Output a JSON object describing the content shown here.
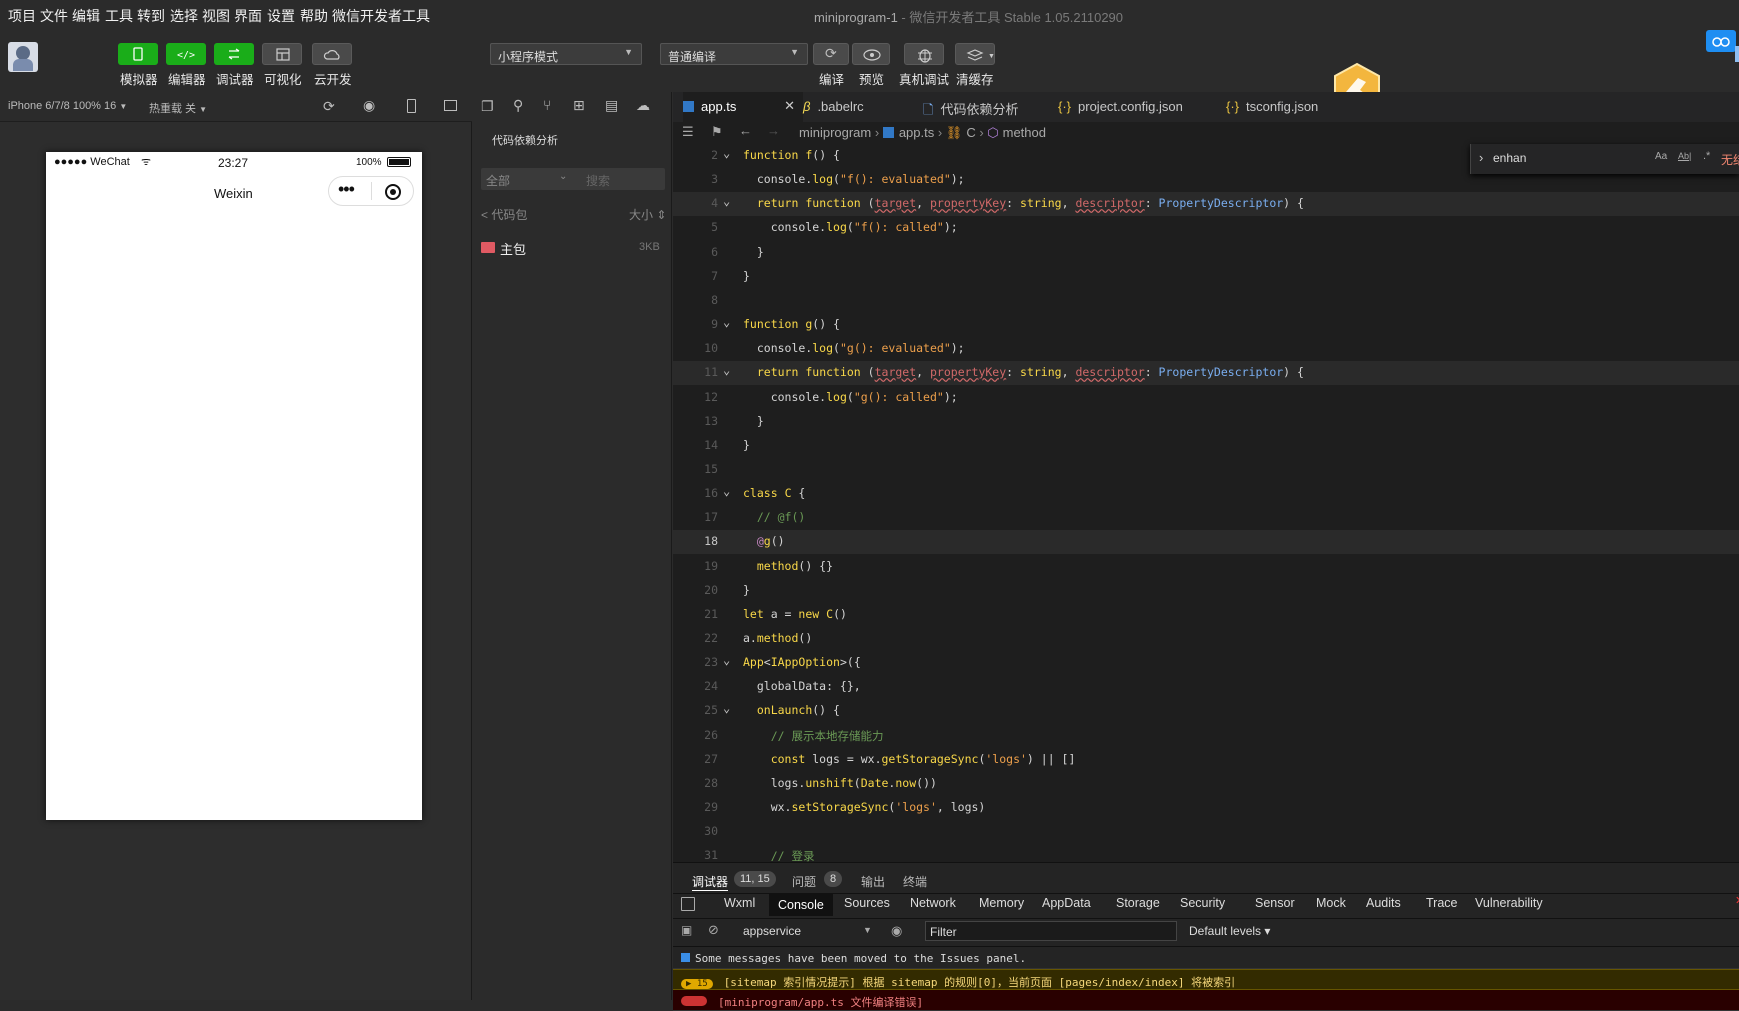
{
  "menu": [
    "项目",
    "文件",
    "编辑",
    "工具",
    "转到",
    "选择",
    "视图",
    "界面",
    "设置",
    "帮助",
    "微信开发者工具"
  ],
  "window_title": {
    "app": "miniprogram-1",
    "rest": " - 微信开发者工具 Stable 1.05.2110290"
  },
  "toolbar": {
    "buttons": [
      "模拟器",
      "编辑器",
      "调试器",
      "可视化",
      "云开发"
    ],
    "mode_select": "小程序模式",
    "compile_select": "普通编译",
    "right_labels": [
      "编译",
      "预览",
      "真机调试",
      "清缓存"
    ]
  },
  "simulator": {
    "device": "iPhone 6/7/8 100% 16",
    "hotreload": "热重载 关",
    "status_left": "●●●●● WeChat",
    "time": "23:27",
    "battery": "100%",
    "nav_title": "Weixin",
    "capsule_dots": "•••"
  },
  "leftpane": {
    "title": "代码依赖分析",
    "filter_all": "全部",
    "search_placeholder": "搜索",
    "back": "< 代码包",
    "size_label": "大小",
    "package": "主包",
    "package_size": "3KB"
  },
  "tabs": [
    {
      "label": "app.ts",
      "icon": "typescript-icon"
    },
    {
      "label": ".babelrc",
      "icon": "babel-icon"
    },
    {
      "label": "代码依赖分析",
      "icon": "file-icon"
    },
    {
      "label": "project.config.json",
      "icon": "json-icon"
    },
    {
      "label": "tsconfig.json",
      "icon": "json-icon"
    }
  ],
  "breadcrumb": [
    "miniprogram",
    "app.ts",
    "C",
    "method"
  ],
  "find": {
    "value": "enhan",
    "no_results": "无结"
  },
  "code_lines": [
    {
      "n": "2",
      "html": "<span class='k'>function</span> <span class='k'>f</span>() {",
      "fold": true
    },
    {
      "n": "3",
      "html": "  console.<span class='k'>log</span>(<span class='s'>\"f(): evaluated\"</span>);"
    },
    {
      "n": "4",
      "html": "  <span class='k'>return</span> <span class='k'>function</span> (<span class='pm'>target</span>, <span class='pm'>propertyKey</span>: <span class='k'>string</span>, <span class='pm'>descriptor</span>: <span class='t'>PropertyDescriptor</span>) {",
      "fold": true,
      "hl": true
    },
    {
      "n": "5",
      "html": "    console.<span class='k'>log</span>(<span class='s'>\"f(): called\"</span>);"
    },
    {
      "n": "6",
      "html": "  }"
    },
    {
      "n": "7",
      "html": "}"
    },
    {
      "n": "8",
      "html": ""
    },
    {
      "n": "9",
      "html": "<span class='k'>function</span> <span class='k'>g</span>() {",
      "fold": true
    },
    {
      "n": "10",
      "html": "  console.<span class='k'>log</span>(<span class='s'>\"g(): evaluated\"</span>);"
    },
    {
      "n": "11",
      "html": "  <span class='k'>return</span> <span class='k'>function</span> (<span class='pm'>target</span>, <span class='pm'>propertyKey</span>: <span class='k'>string</span>, <span class='pm'>descriptor</span>: <span class='t'>PropertyDescriptor</span>) {",
      "fold": true,
      "hl": true
    },
    {
      "n": "12",
      "html": "    console.<span class='k'>log</span>(<span class='s'>\"g(): called\"</span>);"
    },
    {
      "n": "13",
      "html": "  }"
    },
    {
      "n": "14",
      "html": "}"
    },
    {
      "n": "15",
      "html": ""
    },
    {
      "n": "16",
      "html": "<span class='k'>class</span> <span class='k'>C</span> {",
      "fold": true
    },
    {
      "n": "17",
      "html": "  <span class='c'>// @f()</span>"
    },
    {
      "n": "18",
      "html": "  <span class='p'>@</span><span class='k'>g</span>()",
      "cur": true
    },
    {
      "n": "19",
      "html": "  <span class='k'>method</span>() {}"
    },
    {
      "n": "20",
      "html": "}"
    },
    {
      "n": "21",
      "html": "<span class='k'>let</span> a = <span class='k'>new</span> <span class='k'>C</span>()"
    },
    {
      "n": "22",
      "html": "a.<span class='k'>method</span>()"
    },
    {
      "n": "23",
      "html": "<span class='k'>App</span>&lt;<span class='k'>IAppOption</span>&gt;({",
      "fold": true
    },
    {
      "n": "24",
      "html": "  globalData: {},"
    },
    {
      "n": "25",
      "html": "  <span class='k'>onLaunch</span>() {",
      "fold": true
    },
    {
      "n": "26",
      "html": "    <span class='c'>// 展示本地存储能力</span>"
    },
    {
      "n": "27",
      "html": "    <span class='k'>const</span> logs = wx.<span class='k'>getStorageSync</span>(<span class='s'>'logs'</span>) || []"
    },
    {
      "n": "28",
      "html": "    logs.<span class='k'>unshift</span>(<span class='k'>Date</span>.<span class='k'>now</span>())"
    },
    {
      "n": "29",
      "html": "    wx.<span class='k'>setStorageSync</span>(<span class='s'>'logs'</span>, logs)"
    },
    {
      "n": "30",
      "html": ""
    },
    {
      "n": "31",
      "html": "    <span class='c'>// 登录</span>"
    }
  ],
  "bottom": {
    "tab_debugger": "调试器",
    "cursor_pos": "11, 15",
    "tab_issues": "问题",
    "issues_count": "8",
    "tab_output": "输出",
    "tab_terminal": "终端",
    "devtabs": [
      "Wxml",
      "Console",
      "Sources",
      "Network",
      "Memory",
      "AppData",
      "Storage",
      "Security",
      "Sensor",
      "Mock",
      "Audits",
      "Trace",
      "Vulnerability"
    ],
    "context": "appservice",
    "filter_placeholder": "Filter",
    "levels": "Default levels",
    "messages": [
      {
        "text": "Some messages have been moved to the Issues panel.",
        "kind": "info"
      },
      {
        "badge": "15",
        "text": "[sitemap 索引情况提示] 根据 sitemap 的规则[0]，当前页面 [pages/index/index] 将被索引",
        "kind": "warn"
      },
      {
        "text": "[miniprogram/app.ts 文件编译错误]",
        "kind": "error"
      }
    ]
  }
}
